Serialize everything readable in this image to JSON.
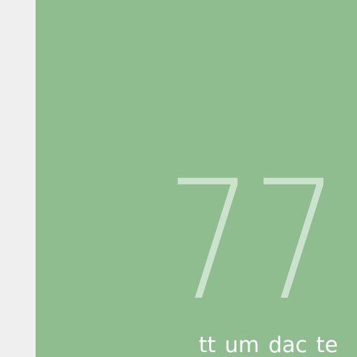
{
  "tile": {
    "value": "77",
    "caption": "tt um dac te",
    "background_color": "#8fbd90",
    "value_color": "#cbe2cc",
    "caption_color": "#ffffff"
  },
  "page": {
    "background_color": "#efefef"
  }
}
